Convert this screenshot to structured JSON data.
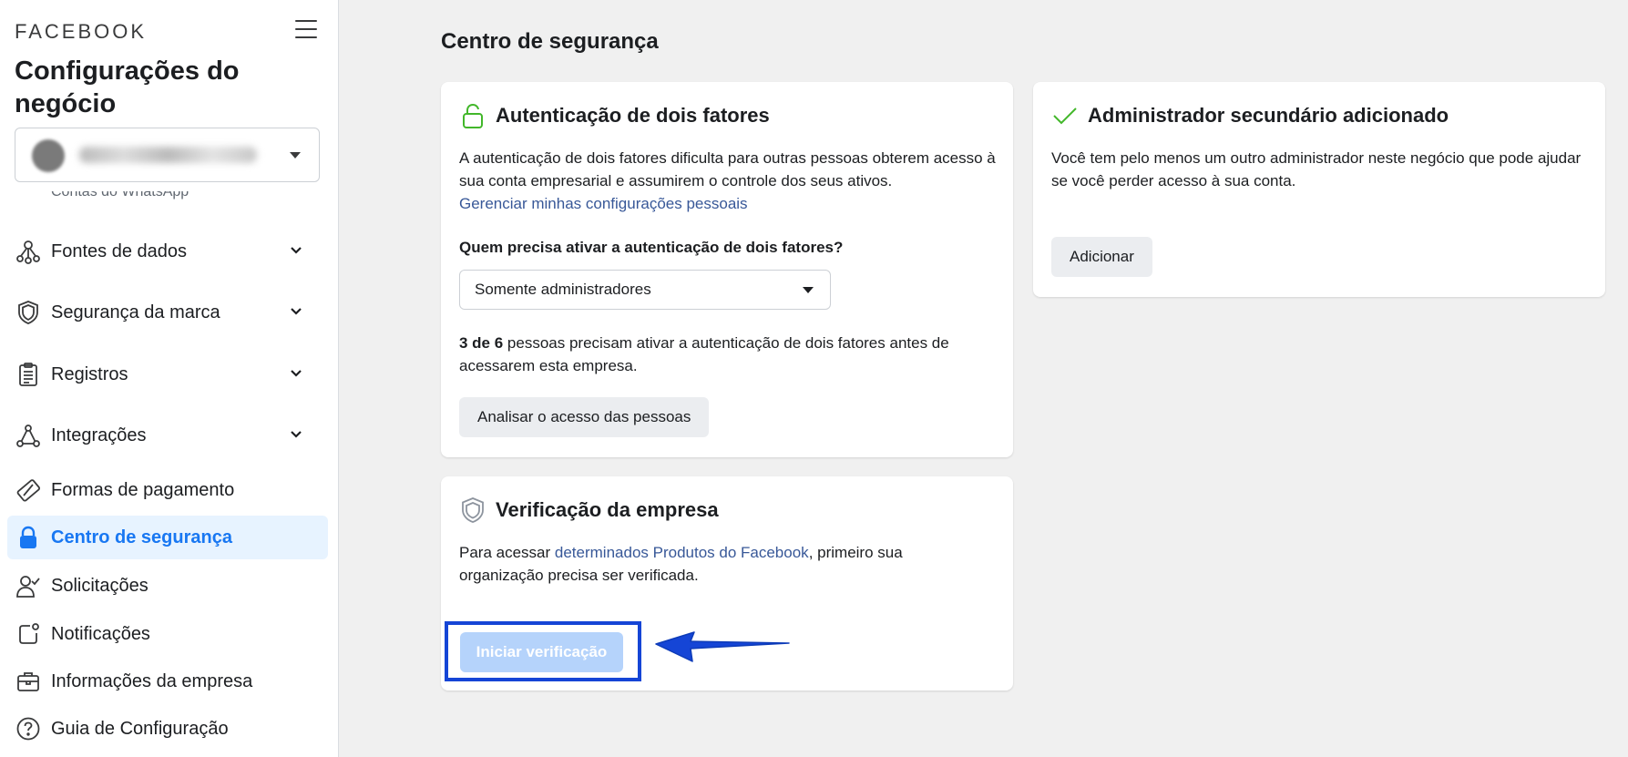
{
  "sidebar": {
    "brand": "FACEBOOK",
    "title": "Configurações do negócio",
    "partial_item": "Contas do WhatsApp",
    "items": [
      {
        "label": "Fontes de dados",
        "icon": "data-sources-icon"
      },
      {
        "label": "Segurança da marca",
        "icon": "shield-icon"
      },
      {
        "label": "Registros",
        "icon": "clipboard-icon"
      },
      {
        "label": "Integrações",
        "icon": "integrations-icon"
      },
      {
        "label": "Formas de pagamento",
        "icon": "credit-card-icon"
      },
      {
        "label": "Centro de segurança",
        "icon": "lock-icon",
        "active": true
      },
      {
        "label": "Solicitações",
        "icon": "person-check-icon"
      },
      {
        "label": "Notificações",
        "icon": "notification-icon"
      },
      {
        "label": "Informações da empresa",
        "icon": "briefcase-icon"
      },
      {
        "label": "Guia de Configuração",
        "icon": "question-icon"
      }
    ]
  },
  "main": {
    "title": "Centro de segurança",
    "two_factor": {
      "title": "Autenticação de dois fatores",
      "description": "A autenticação de dois fatores dificulta para outras pessoas obterem acesso à sua conta empresarial e assumirem o controle dos seus ativos.",
      "link": "Gerenciar minhas configurações pessoais",
      "question": "Quem precisa ativar a autenticação de dois fatores?",
      "select_value": "Somente administradores",
      "count_bold": "3 de 6",
      "count_text": " pessoas precisam ativar a autenticação de dois fatores antes de acessarem esta empresa.",
      "button": "Analisar o acesso das pessoas"
    },
    "admin": {
      "title": "Administrador secundário adicionado",
      "description": "Você tem pelo menos um outro administrador neste negócio que pode ajudar se você perder acesso à sua conta.",
      "button": "Adicionar"
    },
    "verification": {
      "title": "Verificação da empresa",
      "text_before": "Para acessar ",
      "link": "determinados Produtos do Facebook",
      "text_after": ", primeiro sua organização precisa ser verificada.",
      "button": "Iniciar verificação"
    }
  },
  "colors": {
    "accent": "#1877f2",
    "active_bg": "#e7f3ff",
    "link": "#385898",
    "highlight": "#1545d6",
    "check": "#42b72a"
  }
}
